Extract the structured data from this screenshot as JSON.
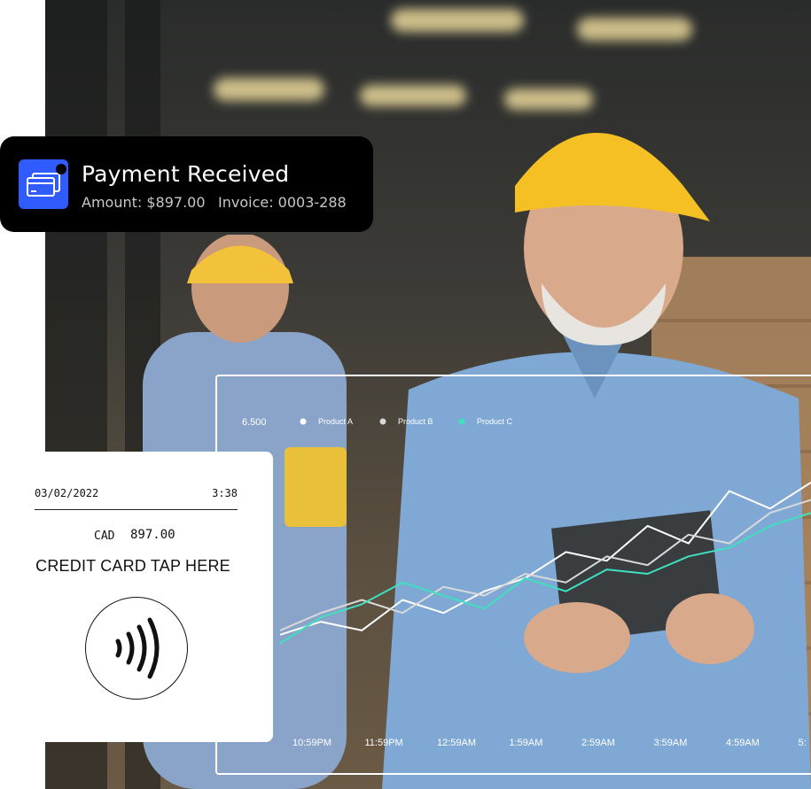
{
  "notification": {
    "title": "Payment Received",
    "amount": "Amount: $897.00",
    "invoice": "Invoice: 0003-288",
    "icon": "payment-card-icon",
    "accent": "#2f5bff"
  },
  "terminal": {
    "date": "03/02/2022",
    "time": "3:38",
    "currency": "CAD",
    "amount": "897.00",
    "instruction": "CREDIT CARD TAP HERE",
    "icon": "contactless-icon"
  },
  "chart_data": {
    "type": "line",
    "title": "",
    "xlabel": "",
    "ylabel": "",
    "y_top_tick": "6.500",
    "categories": [
      "10:59PM",
      "11:59PM",
      "12:59AM",
      "1:59AM",
      "2:59AM",
      "3:59AM",
      "4:59AM",
      "5:"
    ],
    "series": [
      {
        "name": "Product A",
        "color": "#ffffff",
        "values": [
          2.1,
          2.4,
          2.2,
          2.9,
          2.6,
          3.1,
          3.4,
          4.0,
          3.8,
          4.6,
          4.2,
          5.4,
          5.0,
          5.6
        ]
      },
      {
        "name": "Product B",
        "color": "#d9d9d9",
        "values": [
          2.2,
          2.6,
          2.9,
          2.6,
          3.2,
          3.0,
          3.5,
          3.3,
          3.9,
          3.7,
          4.4,
          4.2,
          4.9,
          5.2
        ]
      },
      {
        "name": "Product C",
        "color": "#3fe0c0",
        "values": [
          1.9,
          2.5,
          2.8,
          3.3,
          3.0,
          2.7,
          3.4,
          3.1,
          3.6,
          3.5,
          3.9,
          4.1,
          4.6,
          4.9
        ]
      }
    ],
    "ylim": [
      0,
      7
    ],
    "legend": "top-left",
    "grid": false
  }
}
